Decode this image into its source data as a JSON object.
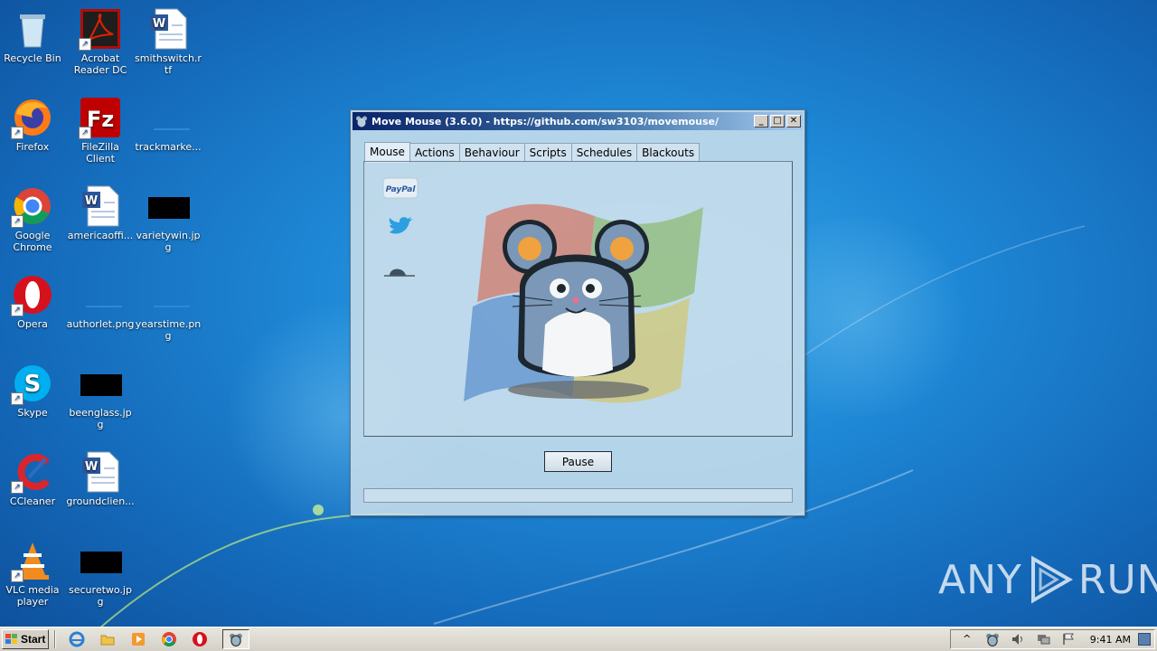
{
  "desktop": {
    "icons": [
      {
        "label": "Recycle Bin",
        "icon": "recycle-bin-icon"
      },
      {
        "label": "Acrobat Reader DC",
        "icon": "acrobat-icon"
      },
      {
        "label": "smithswitch.rtf",
        "icon": "word-document-icon"
      },
      {
        "label": "Firefox",
        "icon": "firefox-icon"
      },
      {
        "label": "FileZilla Client",
        "icon": "filezilla-icon"
      },
      {
        "label": "trackmarke...",
        "icon": "blank-file-icon"
      },
      {
        "label": "Google Chrome",
        "icon": "chrome-icon"
      },
      {
        "label": "americaoffi...",
        "icon": "word-document-icon"
      },
      {
        "label": "varietywin.jpg",
        "icon": "image-file-icon"
      },
      {
        "label": "Opera",
        "icon": "opera-icon"
      },
      {
        "label": "authorlet.png",
        "icon": "blank-file-icon"
      },
      {
        "label": "yearstime.png",
        "icon": "blank-file-icon"
      },
      {
        "label": "Skype",
        "icon": "skype-icon"
      },
      {
        "label": "beenglass.jpg",
        "icon": "image-file-icon"
      },
      {
        "label": "CCleaner",
        "icon": "ccleaner-icon"
      },
      {
        "label": "groundclien...",
        "icon": "word-document-icon"
      },
      {
        "label": "VLC media player",
        "icon": "vlc-icon"
      },
      {
        "label": "securetwo.jpg",
        "icon": "image-file-icon"
      }
    ]
  },
  "window": {
    "title": "Move Mouse (3.6.0) - https://github.com/sw3103/movemouse/",
    "tabs": [
      "Mouse",
      "Actions",
      "Behaviour",
      "Scripts",
      "Schedules",
      "Blackouts"
    ],
    "active_tab": "Mouse",
    "side_icons": {
      "paypal_label": "PayPal"
    },
    "pause_label": "Pause",
    "status_text": ""
  },
  "taskbar": {
    "start_label": "Start",
    "clock": "9:41 AM"
  },
  "watermark": {
    "text_left": "ANY",
    "text_right": "RUN"
  },
  "colors": {
    "desktop_blue": "#1e88d6",
    "titlebar_start": "#0a246a",
    "titlebar_end": "#a6caf0",
    "taskbar": "#d4d0c8"
  }
}
